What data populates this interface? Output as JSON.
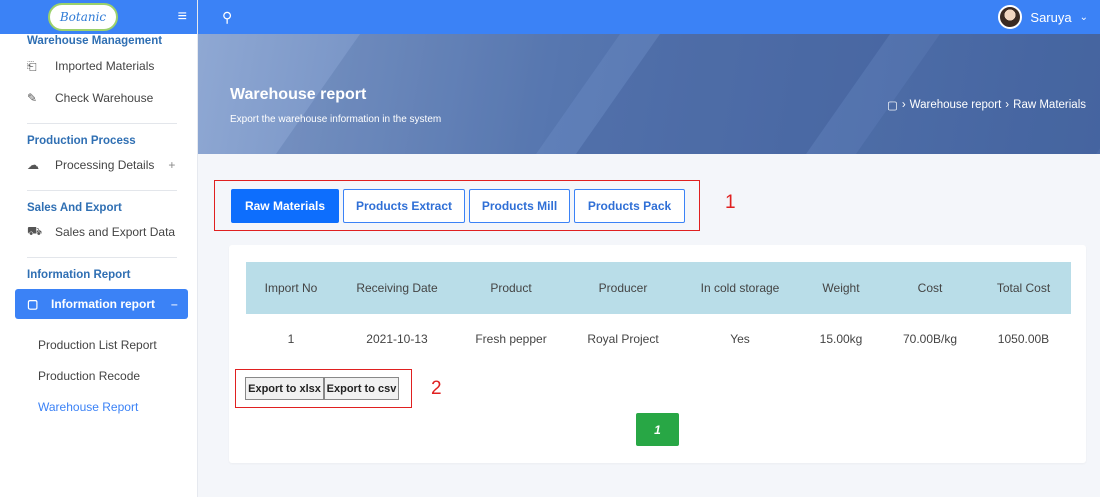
{
  "app": {
    "logo_text": "Botanic"
  },
  "topbar": {
    "user_name": "Saruya"
  },
  "sidebar": {
    "sections": {
      "warehouse": {
        "heading": "Warehouse Management",
        "items": [
          "Imported Materials",
          "Check Warehouse"
        ]
      },
      "production": {
        "heading": "Production Process",
        "items": [
          "Processing Details"
        ]
      },
      "sales": {
        "heading": "Sales And Export",
        "items": [
          "Sales and Export Data"
        ]
      },
      "info": {
        "heading": "Information Report",
        "active": "Information report",
        "subitems": [
          "Production List Report",
          "Production Recode",
          "Warehouse Report"
        ]
      }
    }
  },
  "banner": {
    "title": "Warehouse report",
    "subtitle": "Export the warehouse information in the system",
    "breadcrumb": [
      "Warehouse report",
      "Raw Materials"
    ]
  },
  "tabs": [
    "Raw Materials",
    "Products Extract",
    "Products Mill",
    "Products Pack"
  ],
  "annotations": {
    "tabs": "1",
    "export": "2"
  },
  "table": {
    "columns": [
      "Import No",
      "Receiving Date",
      "Product",
      "Producer",
      "In cold storage",
      "Weight",
      "Cost",
      "Total Cost"
    ],
    "rows": [
      [
        "1",
        "2021-10-13",
        "Fresh pepper",
        "Royal Project",
        "Yes",
        "15.00kg",
        "70.00B/kg",
        "1050.00B"
      ]
    ]
  },
  "export": {
    "xlsx_label": "Export to xlsx",
    "csv_label": "Export to csv"
  },
  "pagination": {
    "current_page": "1"
  }
}
